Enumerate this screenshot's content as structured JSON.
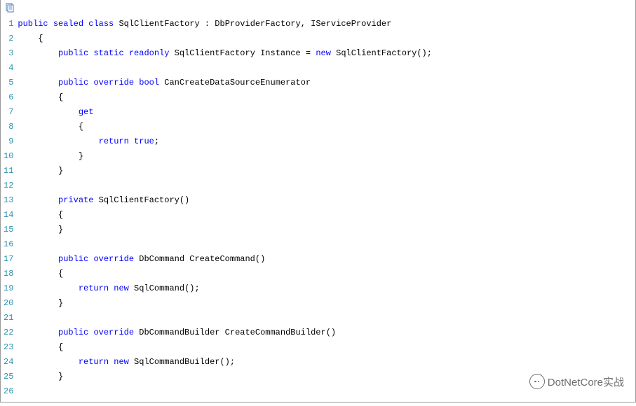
{
  "toolbar": {
    "copy_icon": "copy"
  },
  "code": {
    "lines": [
      {
        "indent": 0,
        "tokens": [
          [
            "kw",
            "public"
          ],
          [
            "pln",
            " "
          ],
          [
            "kw",
            "sealed"
          ],
          [
            "pln",
            " "
          ],
          [
            "kw",
            "class"
          ],
          [
            "pln",
            " SqlClientFactory : DbProviderFactory, IServiceProvider"
          ]
        ]
      },
      {
        "indent": 1,
        "tokens": [
          [
            "pln",
            "{"
          ]
        ]
      },
      {
        "indent": 2,
        "tokens": [
          [
            "kw",
            "public"
          ],
          [
            "pln",
            " "
          ],
          [
            "kw",
            "static"
          ],
          [
            "pln",
            " "
          ],
          [
            "kw",
            "readonly"
          ],
          [
            "pln",
            " SqlClientFactory Instance = "
          ],
          [
            "kw",
            "new"
          ],
          [
            "pln",
            " SqlClientFactory();"
          ]
        ]
      },
      {
        "indent": 0,
        "tokens": []
      },
      {
        "indent": 2,
        "tokens": [
          [
            "kw",
            "public"
          ],
          [
            "pln",
            " "
          ],
          [
            "kw",
            "override"
          ],
          [
            "pln",
            " "
          ],
          [
            "kw",
            "bool"
          ],
          [
            "pln",
            " CanCreateDataSourceEnumerator"
          ]
        ]
      },
      {
        "indent": 2,
        "tokens": [
          [
            "pln",
            "{"
          ]
        ]
      },
      {
        "indent": 3,
        "tokens": [
          [
            "kw",
            "get"
          ]
        ]
      },
      {
        "indent": 3,
        "tokens": [
          [
            "pln",
            "{"
          ]
        ]
      },
      {
        "indent": 4,
        "tokens": [
          [
            "kw",
            "return"
          ],
          [
            "pln",
            " "
          ],
          [
            "kw",
            "true"
          ],
          [
            "pln",
            ";"
          ]
        ]
      },
      {
        "indent": 3,
        "tokens": [
          [
            "pln",
            "}"
          ]
        ]
      },
      {
        "indent": 2,
        "tokens": [
          [
            "pln",
            "}"
          ]
        ]
      },
      {
        "indent": 0,
        "tokens": []
      },
      {
        "indent": 2,
        "tokens": [
          [
            "kw",
            "private"
          ],
          [
            "pln",
            " SqlClientFactory()"
          ]
        ]
      },
      {
        "indent": 2,
        "tokens": [
          [
            "pln",
            "{"
          ]
        ]
      },
      {
        "indent": 2,
        "tokens": [
          [
            "pln",
            "}"
          ]
        ]
      },
      {
        "indent": 0,
        "tokens": []
      },
      {
        "indent": 2,
        "tokens": [
          [
            "kw",
            "public"
          ],
          [
            "pln",
            " "
          ],
          [
            "kw",
            "override"
          ],
          [
            "pln",
            " DbCommand CreateCommand()"
          ]
        ]
      },
      {
        "indent": 2,
        "tokens": [
          [
            "pln",
            "{"
          ]
        ]
      },
      {
        "indent": 3,
        "tokens": [
          [
            "kw",
            "return"
          ],
          [
            "pln",
            " "
          ],
          [
            "kw",
            "new"
          ],
          [
            "pln",
            " SqlCommand();"
          ]
        ]
      },
      {
        "indent": 2,
        "tokens": [
          [
            "pln",
            "}"
          ]
        ]
      },
      {
        "indent": 0,
        "tokens": []
      },
      {
        "indent": 2,
        "tokens": [
          [
            "kw",
            "public"
          ],
          [
            "pln",
            " "
          ],
          [
            "kw",
            "override"
          ],
          [
            "pln",
            " DbCommandBuilder CreateCommandBuilder()"
          ]
        ]
      },
      {
        "indent": 2,
        "tokens": [
          [
            "pln",
            "{"
          ]
        ]
      },
      {
        "indent": 3,
        "tokens": [
          [
            "kw",
            "return"
          ],
          [
            "pln",
            " "
          ],
          [
            "kw",
            "new"
          ],
          [
            "pln",
            " SqlCommandBuilder();"
          ]
        ]
      },
      {
        "indent": 2,
        "tokens": [
          [
            "pln",
            "}"
          ]
        ]
      },
      {
        "indent": 0,
        "tokens": []
      }
    ]
  },
  "watermark": {
    "text": "DotNetCore实战"
  }
}
